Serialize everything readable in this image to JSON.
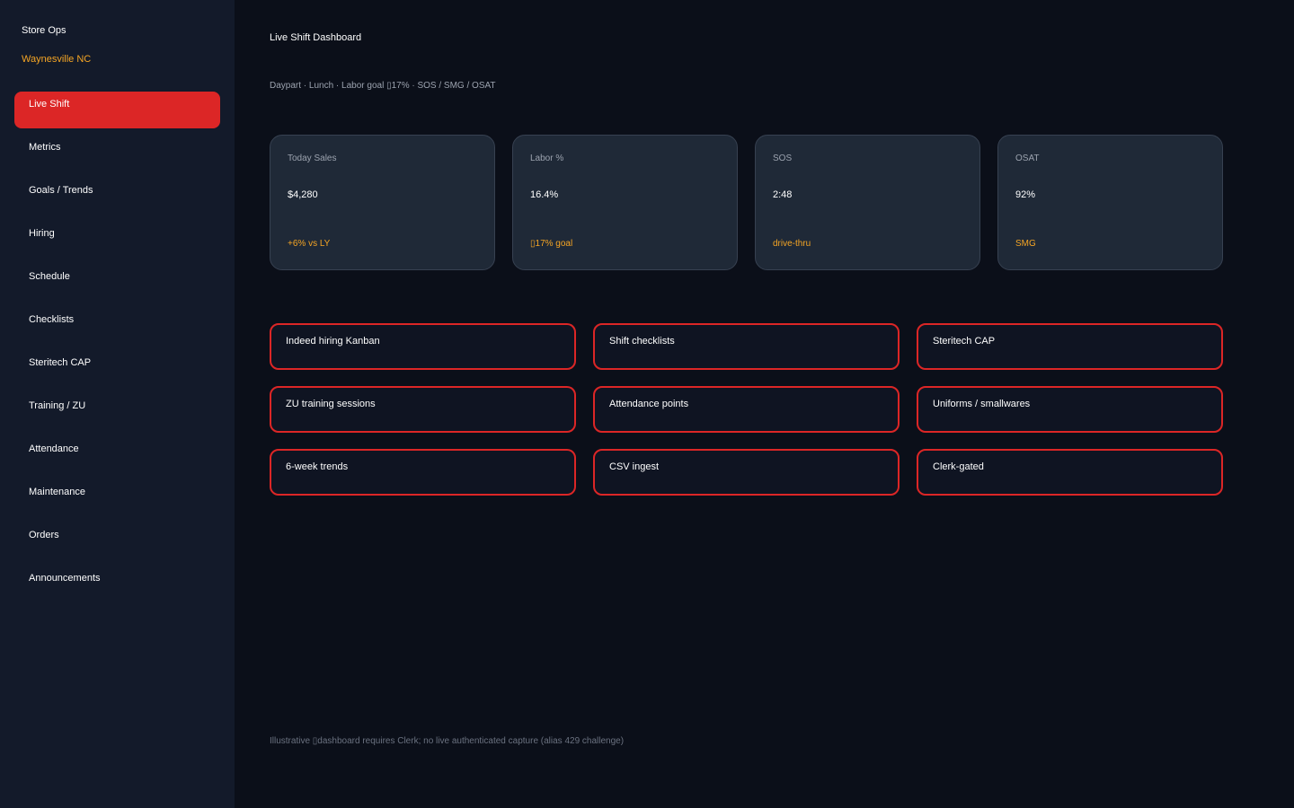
{
  "sidebar": {
    "brand": "Store Ops",
    "location": "Waynesville NC",
    "items": [
      {
        "label": "Live Shift",
        "active": true
      },
      {
        "label": "Metrics"
      },
      {
        "label": "Goals / Trends"
      },
      {
        "label": "Hiring"
      },
      {
        "label": "Schedule"
      },
      {
        "label": "Checklists"
      },
      {
        "label": "Steritech CAP"
      },
      {
        "label": "Training / ZU"
      },
      {
        "label": "Attendance"
      },
      {
        "label": "Maintenance"
      },
      {
        "label": "Orders"
      },
      {
        "label": "Announcements"
      }
    ]
  },
  "main": {
    "title": "Live Shift Dashboard",
    "subtitle": "Daypart · Lunch · Labor goal ▯17% · SOS / SMG / OSAT",
    "kpis": [
      {
        "label": "Today Sales",
        "value": "$4,280",
        "note": "+6% vs LY"
      },
      {
        "label": "Labor %",
        "value": "16.4%",
        "note": "▯17% goal"
      },
      {
        "label": "SOS",
        "value": "2:48",
        "note": "drive-thru"
      },
      {
        "label": "OSAT",
        "value": "92%",
        "note": "SMG"
      }
    ],
    "tiles": [
      {
        "label": "Indeed hiring Kanban"
      },
      {
        "label": "Shift checklists"
      },
      {
        "label": "Steritech CAP"
      },
      {
        "label": "ZU training sessions"
      },
      {
        "label": "Attendance points"
      },
      {
        "label": "Uniforms / smallwares"
      },
      {
        "label": "6-week trends"
      },
      {
        "label": "CSV ingest"
      },
      {
        "label": "Clerk-gated"
      }
    ],
    "footer": "Illustrative ▯dashboard requires Clerk; no live authenticated capture (alias 429 challenge)"
  },
  "colors": {
    "accent": "#dc2626",
    "highlight": "#f5a524",
    "sidebar_bg": "#131a2a",
    "page_bg": "#0b0f19",
    "card_bg": "#1f2937"
  }
}
